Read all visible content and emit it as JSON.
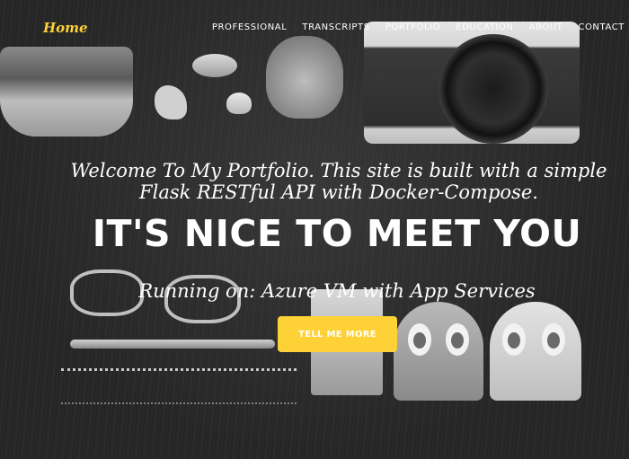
{
  "navbar": {
    "brand": "Home",
    "links": [
      {
        "label": "PROFESSIONAL"
      },
      {
        "label": "TRANSCRIPTS"
      },
      {
        "label": "PORTFOLIO"
      },
      {
        "label": "EDUCATION"
      },
      {
        "label": "ABOUT"
      },
      {
        "label": "CONTACT"
      }
    ]
  },
  "hero": {
    "welcome_line1": "Welcome To My Portfolio. This site is built with a simple",
    "welcome_line2": "Flask RESTful API with Docker-Compose.",
    "heading": "IT'S NICE TO MEET YOU",
    "running": "Running on: Azure VM with App Services",
    "cta_label": "TELL ME MORE"
  },
  "colors": {
    "accent": "#fed136",
    "text": "#ffffff",
    "background": "#252525"
  }
}
